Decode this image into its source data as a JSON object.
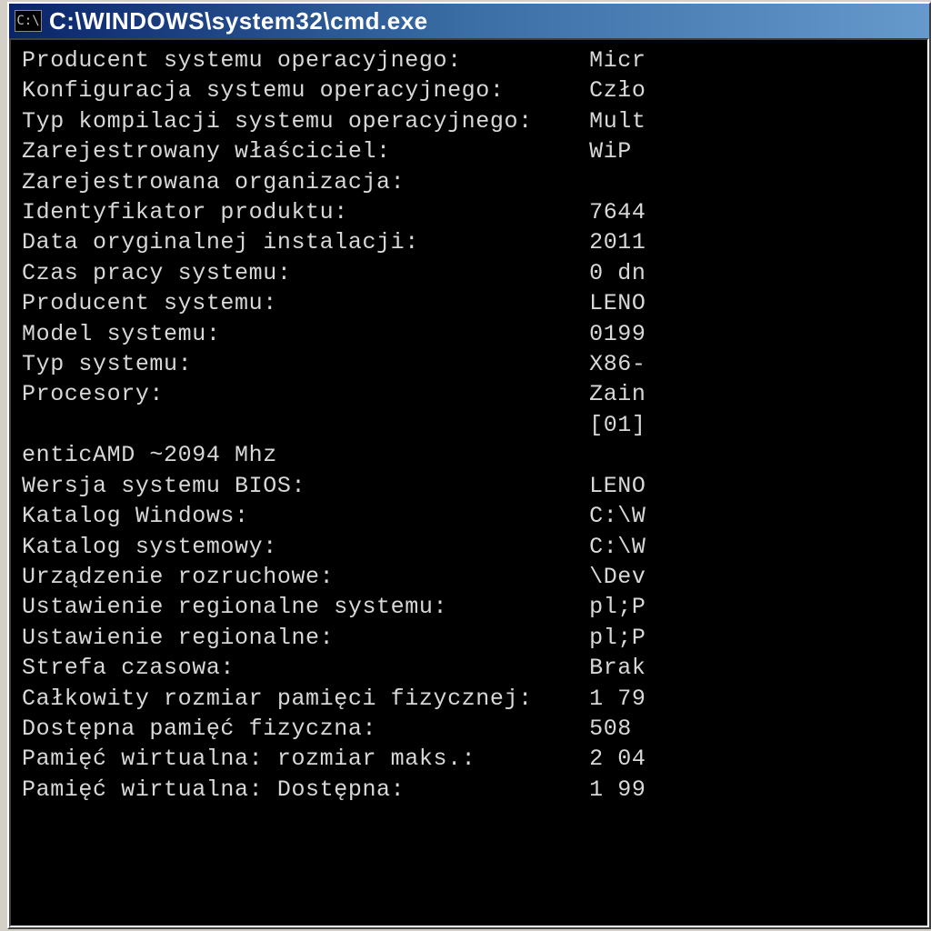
{
  "window": {
    "title": "C:\\WINDOWS\\system32\\cmd.exe",
    "icon_label": "cmd-icon",
    "icon_text": "C:\\"
  },
  "value_column": 40,
  "rows": [
    {
      "label": "Producent systemu operacyjnego:",
      "value": "Micr"
    },
    {
      "label": "Konfiguracja systemu operacyjnego:",
      "value": "Czło"
    },
    {
      "label": "Typ kompilacji systemu operacyjnego:",
      "value": "Mult"
    },
    {
      "label": "Zarejestrowany właściciel:",
      "value": "WiP"
    },
    {
      "label": "Zarejestrowana organizacja:",
      "value": ""
    },
    {
      "label": "Identyfikator produktu:",
      "value": "7644"
    },
    {
      "label": "Data oryginalnej instalacji:",
      "value": "2011"
    },
    {
      "label": "Czas pracy systemu:",
      "value": "0 dn"
    },
    {
      "label": "Producent systemu:",
      "value": "LENO"
    },
    {
      "label": "Model systemu:",
      "value": "0199"
    },
    {
      "label": "Typ systemu:",
      "value": "X86-"
    },
    {
      "label": "Procesory:",
      "value": "Zain"
    },
    {
      "label": "",
      "value": "[01]"
    },
    {
      "label": "enticAMD ~2094 Mhz",
      "value": null
    },
    {
      "label": "Wersja systemu BIOS:",
      "value": "LENO"
    },
    {
      "label": "Katalog Windows:",
      "value": "C:\\W"
    },
    {
      "label": "Katalog systemowy:",
      "value": "C:\\W"
    },
    {
      "label": "Urządzenie rozruchowe:",
      "value": "\\Dev"
    },
    {
      "label": "Ustawienie regionalne systemu:",
      "value": "pl;P"
    },
    {
      "label": "Ustawienie regionalne:",
      "value": "pl;P"
    },
    {
      "label": "Strefa czasowa:",
      "value": "Brak"
    },
    {
      "label": "Całkowity rozmiar pamięci fizycznej:",
      "value": "1 79"
    },
    {
      "label": "Dostępna pamięć fizyczna:",
      "value": "508"
    },
    {
      "label": "Pamięć wirtualna: rozmiar maks.:",
      "value": "2 04"
    },
    {
      "label": "Pamięć wirtualna: Dostępna:",
      "value": "1 99"
    }
  ]
}
